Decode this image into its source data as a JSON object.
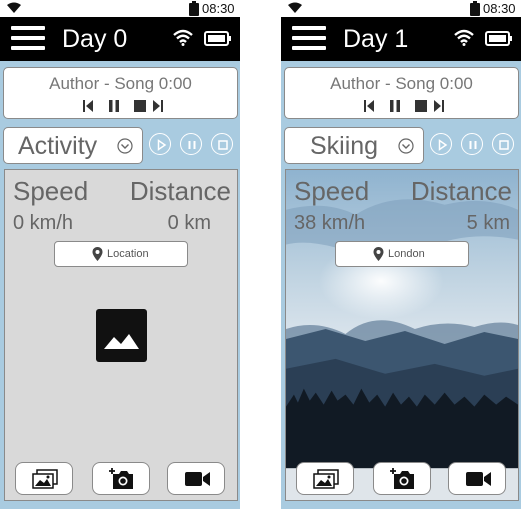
{
  "statusbar": {
    "time": "08:30"
  },
  "screens": [
    {
      "title": "Day 0",
      "music": {
        "track": "Author - Song 0:00"
      },
      "activity": "Activity",
      "speed_label": "Speed",
      "distance_label": "Distance",
      "speed_value": "0 km/h",
      "distance_value": "0 km",
      "location": "Location",
      "background": "placeholder"
    },
    {
      "title": "Day 1",
      "music": {
        "track": "Author - Song 0:00"
      },
      "activity": "Skiing",
      "speed_label": "Speed",
      "distance_label": "Distance",
      "speed_value": "38 km/h",
      "distance_value": "5 km",
      "location": "London",
      "background": "mountain-photo"
    }
  ],
  "icons": [
    "wifi-icon",
    "battery-icon",
    "menu-icon",
    "previous-icon",
    "pause-icon",
    "stop-icon",
    "next-icon",
    "chevron-down-icon",
    "play-icon",
    "location-pin-icon",
    "image-icon",
    "gallery-icon",
    "add-photo-icon",
    "video-camera-icon"
  ],
  "colors": {
    "appbar": "#000000",
    "body": "#a9cbe0",
    "panel": "#d9d9d9",
    "text_gray": "#666666"
  }
}
